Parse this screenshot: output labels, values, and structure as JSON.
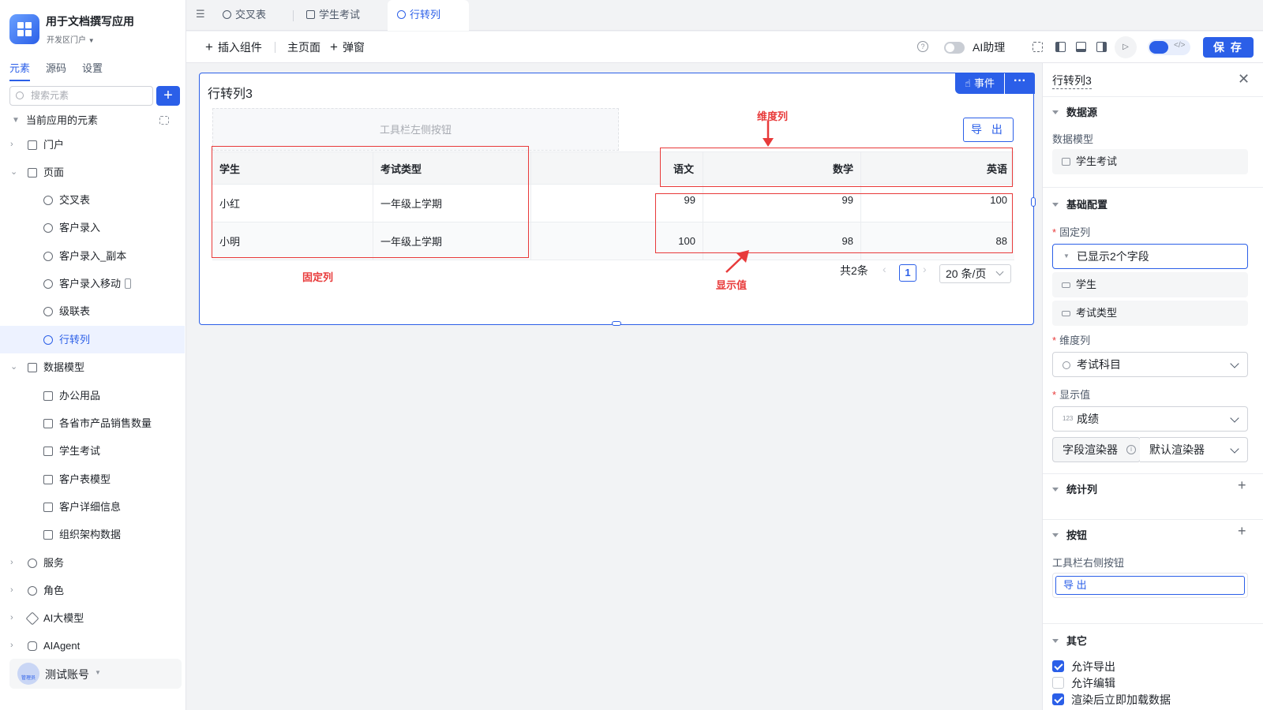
{
  "app": {
    "title": "用于文档撰写应用",
    "subtitle": "开发区门户"
  },
  "sidebar": {
    "tabs": [
      "元素",
      "源码",
      "设置"
    ],
    "search_placeholder": "搜索元素",
    "section_label": "当前应用的元素",
    "items": [
      {
        "label": "门户"
      },
      {
        "label": "页面"
      },
      {
        "label": "交叉表"
      },
      {
        "label": "客户录入"
      },
      {
        "label": "客户录入_副本"
      },
      {
        "label": "客户录入移动"
      },
      {
        "label": "级联表"
      },
      {
        "label": "行转列"
      },
      {
        "label": "数据模型"
      },
      {
        "label": "办公用品"
      },
      {
        "label": "各省市产品销售数量"
      },
      {
        "label": "学生考试"
      },
      {
        "label": "客户表模型"
      },
      {
        "label": "客户详细信息"
      },
      {
        "label": "组织架构数据"
      },
      {
        "label": "服务"
      },
      {
        "label": "角色"
      },
      {
        "label": "AI大模型"
      },
      {
        "label": "AIAgent"
      }
    ],
    "user": {
      "name": "测试账号",
      "avatar_text": "管理员"
    }
  },
  "tabs": [
    "交叉表",
    "学生考试",
    "行转列"
  ],
  "toolbar": {
    "insert": "插入组件",
    "main_page": "主页面",
    "popup": "弹窗",
    "ai_assistant": "AI助理",
    "save": "保 存"
  },
  "component": {
    "title": "行转列3",
    "event_label": "事件",
    "more_label": "···",
    "left_toolbar_placeholder": "工具栏左侧按钮",
    "export_label": "导 出",
    "columns": [
      "学生",
      "考试类型",
      "语文",
      "数学",
      "英语"
    ],
    "rows": [
      [
        "小红",
        "一年级上学期",
        "99",
        "99",
        "100"
      ],
      [
        "小明",
        "一年级上学期",
        "100",
        "98",
        "88"
      ]
    ],
    "pager": {
      "total": "共2条",
      "page": "1",
      "size": "20 条/页"
    },
    "annotations": {
      "dimension": "维度列",
      "fixed": "固定列",
      "value": "显示值"
    }
  },
  "panel": {
    "title": "行转列3",
    "data_source": "数据源",
    "data_model_label": "数据模型",
    "data_model_value": "学生考试",
    "basic_config": "基础配置",
    "fixed_cols_label": "固定列",
    "fixed_cols_summary": "已显示2个字段",
    "fixed_fields": [
      "学生",
      "考试类型"
    ],
    "dimension_label": "维度列",
    "dimension_value": "考试科目",
    "value_label": "显示值",
    "value_value": "成绩",
    "renderer_label": "字段渲染器",
    "renderer_value": "默认渲染器",
    "stats_col": "统计列",
    "buttons": "按钮",
    "right_toolbar_label": "工具栏右侧按钮",
    "right_toolbar_button": "导 出",
    "other": "其它",
    "checks": [
      {
        "label": "允许导出",
        "checked": true
      },
      {
        "label": "允许编辑",
        "checked": false
      },
      {
        "label": "渲染后立即加载数据",
        "checked": true
      }
    ]
  },
  "colors": {
    "accent": "#2b5fe8",
    "annotation": "#e83a3a"
  }
}
